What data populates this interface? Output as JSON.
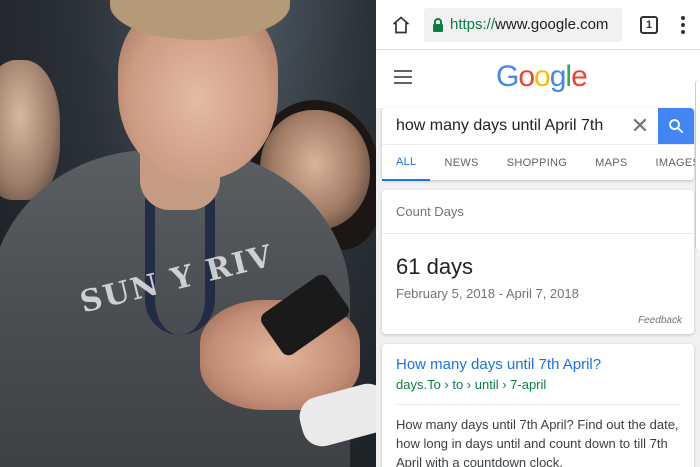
{
  "browser": {
    "url_scheme": "https://",
    "url_host": "www.google.com",
    "tab_count": "1"
  },
  "google": {
    "logo_letters": [
      "G",
      "o",
      "o",
      "g",
      "l",
      "e"
    ]
  },
  "search": {
    "query": "how many days until April 7th",
    "tabs": [
      {
        "label": "ALL",
        "active": true
      },
      {
        "label": "NEWS",
        "active": false
      },
      {
        "label": "SHOPPING",
        "active": false
      },
      {
        "label": "MAPS",
        "active": false
      },
      {
        "label": "IMAGES",
        "active": false
      }
    ]
  },
  "answer": {
    "title": "Count Days",
    "value": "61 days",
    "range": "February 5, 2018 - April 7, 2018",
    "feedback": "Feedback"
  },
  "result": {
    "title": "How many days until 7th April?",
    "url": "days.To › to › until › 7-april",
    "snippet": "How many days until 7th April? Find out the date, how long in days until and count down to till 7th April with a countdown clock."
  },
  "photo": {
    "hoodie_text": "SUN  Y RIV"
  },
  "colors": {
    "accent": "#4285f4",
    "link": "#1a73e8",
    "url_green": "#0b8043"
  }
}
